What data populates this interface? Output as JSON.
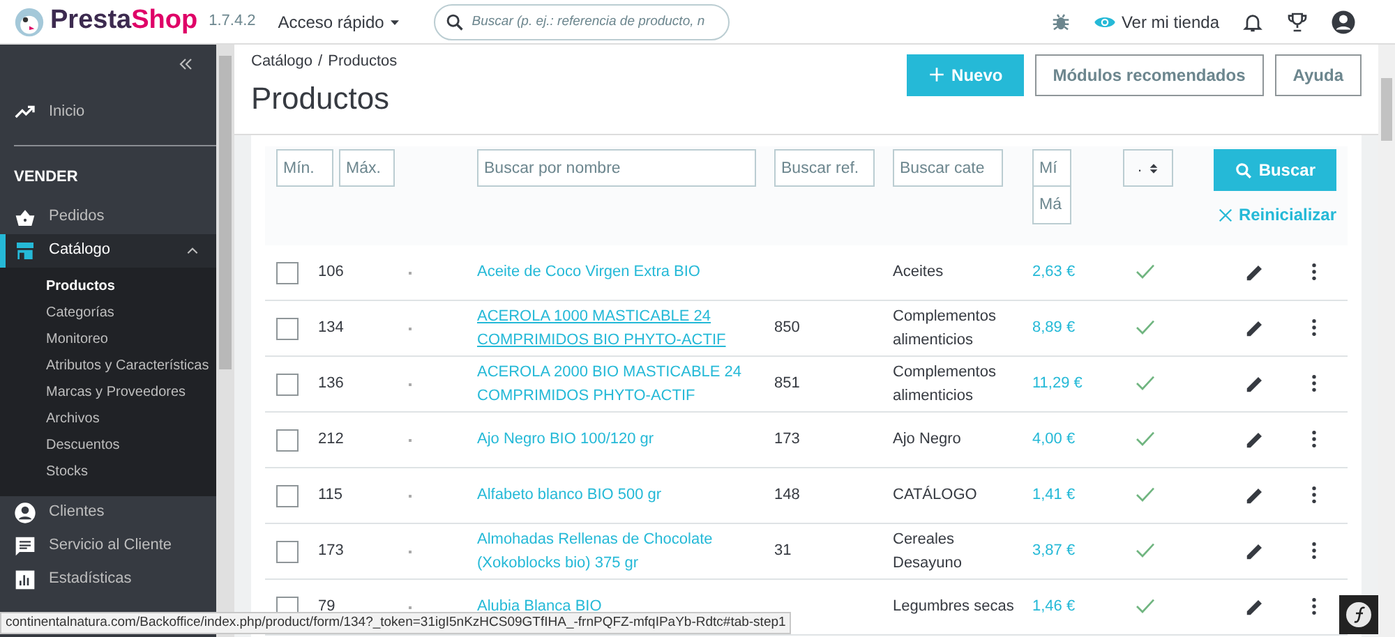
{
  "header": {
    "brand_a": "Presta",
    "brand_b": "Shop",
    "version": "1.7.4.2",
    "quick_access": "Acceso rápido",
    "search": {
      "placeholder": "Buscar (p. ej.: referencia de producto, n"
    },
    "view_store": "Ver mi tienda"
  },
  "sidebar": {
    "items": [
      {
        "kind": "link",
        "label": "Inicio"
      },
      {
        "kind": "section",
        "label": "VENDER"
      },
      {
        "kind": "link",
        "label": "Pedidos"
      },
      {
        "kind": "group",
        "label": "Catálogo",
        "expanded": true,
        "selected": true,
        "children": [
          {
            "label": "Productos",
            "selected": true
          },
          {
            "label": "Categorías",
            "selected": false
          },
          {
            "label": "Monitoreo",
            "selected": false
          },
          {
            "label": "Atributos y Características",
            "selected": false
          },
          {
            "label": "Marcas y Proveedores",
            "selected": false
          },
          {
            "label": "Archivos",
            "selected": false
          },
          {
            "label": "Descuentos",
            "selected": false
          },
          {
            "label": "Stocks",
            "selected": false
          }
        ]
      },
      {
        "kind": "link",
        "label": "Clientes"
      },
      {
        "kind": "link",
        "label": "Servicio al Cliente"
      },
      {
        "kind": "link",
        "label": "Estadísticas"
      }
    ]
  },
  "breadcrumb": [
    "Catálogo",
    "Productos"
  ],
  "breadcrumb_separator": "/",
  "title": "Productos",
  "actions": [
    {
      "kind": "primary",
      "label": "Nuevo"
    },
    {
      "kind": "outline",
      "label": "Módulos recomendados"
    },
    {
      "kind": "outline",
      "label": "Ayuda"
    }
  ],
  "filters": {
    "id_min": {
      "placeholder": "Mín."
    },
    "id_max": {
      "placeholder": "Máx."
    },
    "name": {
      "placeholder": "Buscar por nombre"
    },
    "ref": {
      "placeholder": "Buscar ref."
    },
    "category": {
      "placeholder": "Buscar cate"
    },
    "price_min": {
      "placeholder": "Mí"
    },
    "price_max": {
      "placeholder": "Má"
    },
    "active": ".",
    "search_button": "Buscar",
    "reset": "Reinicializar"
  },
  "rows": [
    {
      "checked": false,
      "id": "106",
      "name": "Aceite de Coco Virgen Extra BIO",
      "underlined": false,
      "ref": "",
      "category": "Aceites",
      "price": "2,63 €",
      "active": true
    },
    {
      "checked": false,
      "id": "134",
      "name": "ACEROLA 1000 MASTICABLE 24 COMPRIMIDOS BIO PHYTO-ACTIF",
      "underlined": true,
      "ref": "850",
      "category": "Complementos alimenticios",
      "price": "8,89 €",
      "active": true
    },
    {
      "checked": false,
      "id": "136",
      "name": "ACEROLA 2000 BIO MASTICABLE 24 COMPRIMIDOS PHYTO-ACTIF",
      "underlined": false,
      "ref": "851",
      "category": "Complementos alimenticios",
      "price": "11,29 €",
      "active": true
    },
    {
      "checked": false,
      "id": "212",
      "name": "Ajo Negro BIO 100/120 gr",
      "underlined": false,
      "ref": "173",
      "category": "Ajo Negro",
      "price": "4,00 €",
      "active": true
    },
    {
      "checked": false,
      "id": "115",
      "name": "Alfabeto blanco BIO 500 gr",
      "underlined": false,
      "ref": "148",
      "category": "CATÁLOGO",
      "price": "1,41 €",
      "active": true
    },
    {
      "checked": false,
      "id": "173",
      "name": "Almohadas Rellenas de Chocolate (Xokoblocks bio) 375 gr",
      "underlined": false,
      "ref": "31",
      "category": "Cereales Desayuno",
      "price": "3,87 €",
      "active": true
    },
    {
      "checked": false,
      "id": "79",
      "name": "Alubia Blanca BIO",
      "underlined": false,
      "ref": "",
      "category": "Legumbres secas",
      "price": "1,46 €",
      "active": true
    }
  ],
  "status_url": "continentalnatura.com/Backoffice/index.php/product/form/134?_token=31igI5nKzHCS09GTfIHA_-frnPQFZ-mfqIPaYb-Rdtc#tab-step1"
}
